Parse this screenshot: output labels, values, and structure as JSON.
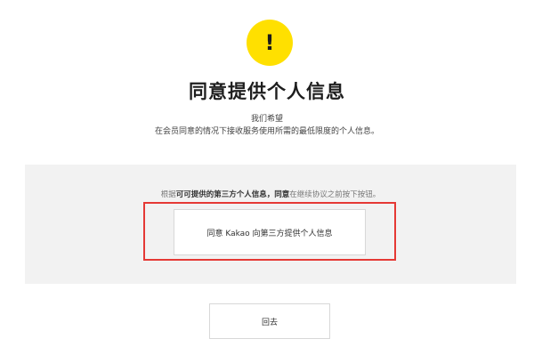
{
  "header": {
    "icon_glyph": "!",
    "icon_name": "exclamation-icon",
    "accent_color": "#ffe000",
    "title": "同意提供个人信息",
    "subtitle_line1": "我们希望",
    "subtitle_line2": "在会员同意的情况下接收服务使用所需的最低限度的个人信息。"
  },
  "consent": {
    "notice_prefix": "根据",
    "notice_bold1": "可可提供的第三方个人信息，同意",
    "notice_suffix": "在继续协议之前按下按钮。",
    "agree_button_label": "同意 Kakao 向第三方提供个人信息",
    "highlight_color": "#e53935"
  },
  "footer": {
    "back_button_label": "回去"
  }
}
